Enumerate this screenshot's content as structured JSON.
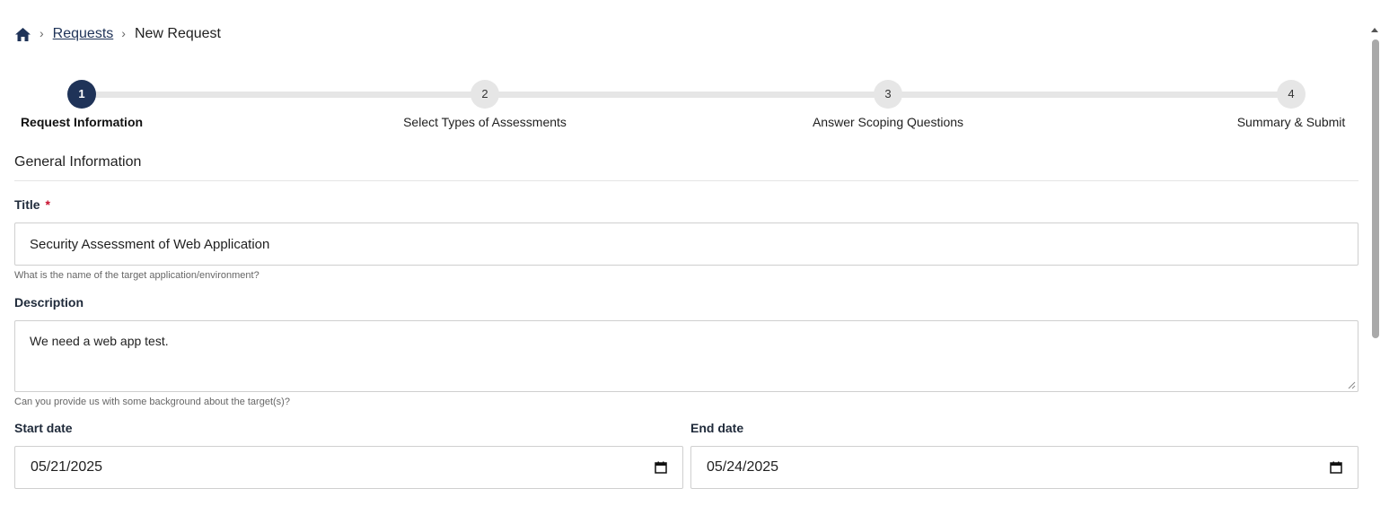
{
  "breadcrumb": {
    "home_icon": "home-icon",
    "separator": "›",
    "parent": "Requests",
    "current": "New Request"
  },
  "stepper": {
    "active_step": 1,
    "steps": [
      {
        "number": "1",
        "label": "Request Information"
      },
      {
        "number": "2",
        "label": "Select Types of Assessments"
      },
      {
        "number": "3",
        "label": "Answer Scoping Questions"
      },
      {
        "number": "4",
        "label": "Summary & Submit"
      }
    ]
  },
  "section": {
    "title": "General Information"
  },
  "form": {
    "title": {
      "label": "Title",
      "required_marker": "*",
      "value": "Security Assessment of Web Application",
      "help": "What is the name of the target application/environment?"
    },
    "description": {
      "label": "Description",
      "value": "We need a web app test.",
      "help": "Can you provide us with some background about the target(s)?"
    },
    "start_date": {
      "label": "Start date",
      "value": "05/21/2025"
    },
    "end_date": {
      "label": "End date",
      "value": "05/24/2025"
    }
  },
  "colors": {
    "accent": "#1f3358",
    "inactive_step": "#e6e6e6",
    "required": "#c8102e",
    "border": "#cfcfcf"
  }
}
